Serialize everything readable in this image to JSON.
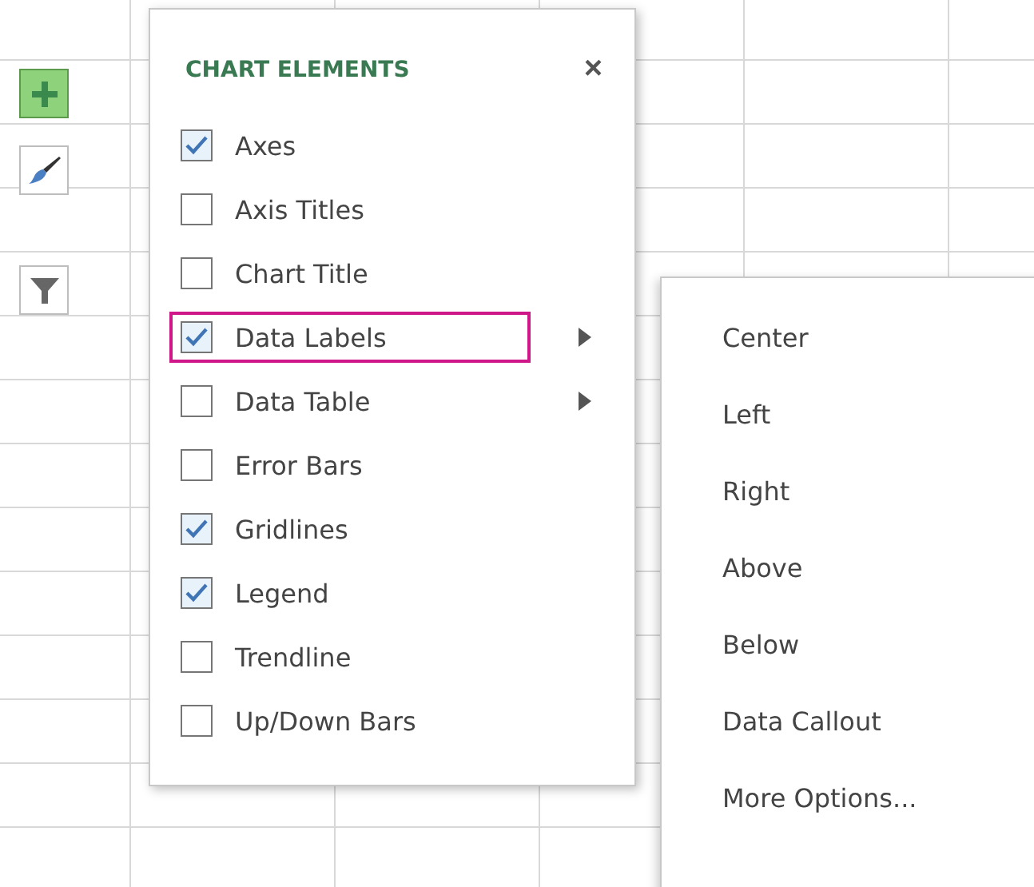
{
  "side_buttons": [
    {
      "kind": "add",
      "selected": true
    },
    {
      "kind": "style",
      "selected": false
    },
    {
      "kind": "filter",
      "selected": false
    }
  ],
  "panel": {
    "title": "CHART ELEMENTS",
    "close": "×",
    "items": [
      {
        "label": "Axes",
        "checked": true,
        "selected": false,
        "has_submenu": false
      },
      {
        "label": "Axis Titles",
        "checked": false,
        "selected": false,
        "has_submenu": false
      },
      {
        "label": "Chart Title",
        "checked": false,
        "selected": false,
        "has_submenu": false
      },
      {
        "label": "Data Labels",
        "checked": true,
        "selected": true,
        "has_submenu": true
      },
      {
        "label": "Data Table",
        "checked": false,
        "selected": false,
        "has_submenu": true
      },
      {
        "label": "Error Bars",
        "checked": false,
        "selected": false,
        "has_submenu": false
      },
      {
        "label": "Gridlines",
        "checked": true,
        "selected": false,
        "has_submenu": false
      },
      {
        "label": "Legend",
        "checked": true,
        "selected": false,
        "has_submenu": false
      },
      {
        "label": "Trendline",
        "checked": false,
        "selected": false,
        "has_submenu": false
      },
      {
        "label": "Up/Down Bars",
        "checked": false,
        "selected": false,
        "has_submenu": false
      }
    ]
  },
  "submenu": {
    "items": [
      "Center",
      "Left",
      "Right",
      "Above",
      "Below",
      "Data Callout",
      "More Options..."
    ]
  }
}
